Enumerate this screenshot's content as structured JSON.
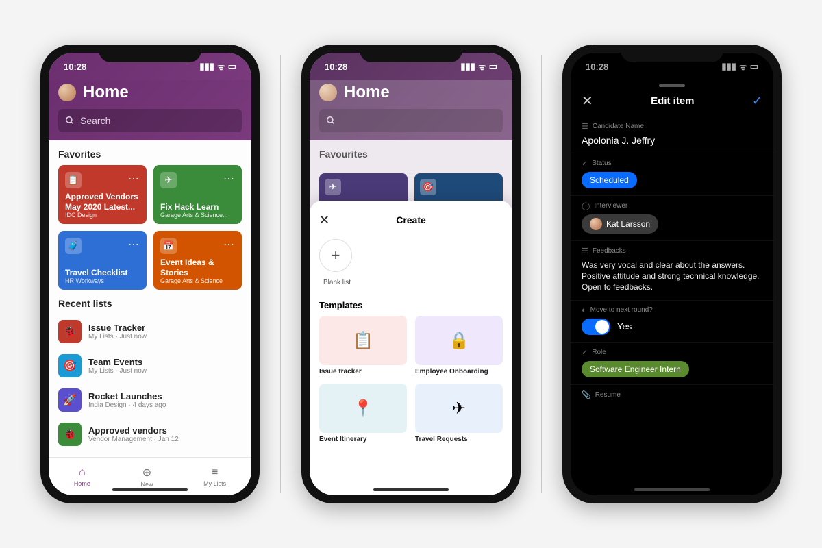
{
  "statusbar": {
    "time": "10:28"
  },
  "screen1": {
    "title": "Home",
    "search_placeholder": "Search",
    "favorites_heading": "Favorites",
    "favorites": [
      {
        "title": "Approved Vendors May 2020 Latest...",
        "subtitle": "IDC Design",
        "color": "#c0392b",
        "icon": "📋"
      },
      {
        "title": "Fix Hack Learn",
        "subtitle": "Garage Arts & Science...",
        "color": "#3a8c3a",
        "icon": "✈"
      },
      {
        "title": "Travel Checklist",
        "subtitle": "HR Workways",
        "color": "#2e6fd6",
        "icon": "🧳"
      },
      {
        "title": "Event Ideas & Stories",
        "subtitle": "Garage Arts & Science",
        "color": "#d35400",
        "icon": "📅"
      }
    ],
    "recent_heading": "Recent lists",
    "recent": [
      {
        "title": "Issue Tracker",
        "subtitle": "My Lists · Just now",
        "color": "#c0392b",
        "icon": "🐞"
      },
      {
        "title": "Team Events",
        "subtitle": "My Lists · Just now",
        "color": "#1a9bd6",
        "icon": "🎯"
      },
      {
        "title": "Rocket Launches",
        "subtitle": "India Design · 4 days ago",
        "color": "#5a4fcf",
        "icon": "🚀"
      },
      {
        "title": "Approved vendors",
        "subtitle": "Vendor Management · Jan 12",
        "color": "#3a8c3a",
        "icon": "🐞"
      }
    ],
    "tabs": {
      "home": "Home",
      "new": "New",
      "mylists": "My Lists"
    }
  },
  "screen2": {
    "title": "Home",
    "favorites_heading": "Favourites",
    "sheet": {
      "title": "Create",
      "blank_label": "Blank list",
      "templates_heading": "Templates",
      "templates": [
        {
          "label": "Issue tracker",
          "bg": "#fde8e8",
          "icon": "📋"
        },
        {
          "label": "Employee Onboarding",
          "bg": "#efe7fb",
          "icon": "🔒"
        },
        {
          "label": "Event Itinerary",
          "bg": "#e4f2f6",
          "icon": "📍"
        },
        {
          "label": "Travel Requests",
          "bg": "#e8f0fb",
          "icon": "✈"
        }
      ]
    }
  },
  "screen3": {
    "header_title": "Edit item",
    "fields": {
      "candidate_label": "Candidate Name",
      "candidate_value": "Apolonia J. Jeffry",
      "status_label": "Status",
      "status_value": "Scheduled",
      "interviewer_label": "Interviewer",
      "interviewer_value": "Kat Larsson",
      "feedbacks_label": "Feedbacks",
      "feedbacks_value": "Was very vocal and clear about the answers. Positive attitude and strong technical knowledge. Open to feedbacks.",
      "next_round_label": "Move to next round?",
      "next_round_value": "Yes",
      "role_label": "Role",
      "role_value": "Software Engineer Intern",
      "resume_label": "Resume"
    }
  }
}
